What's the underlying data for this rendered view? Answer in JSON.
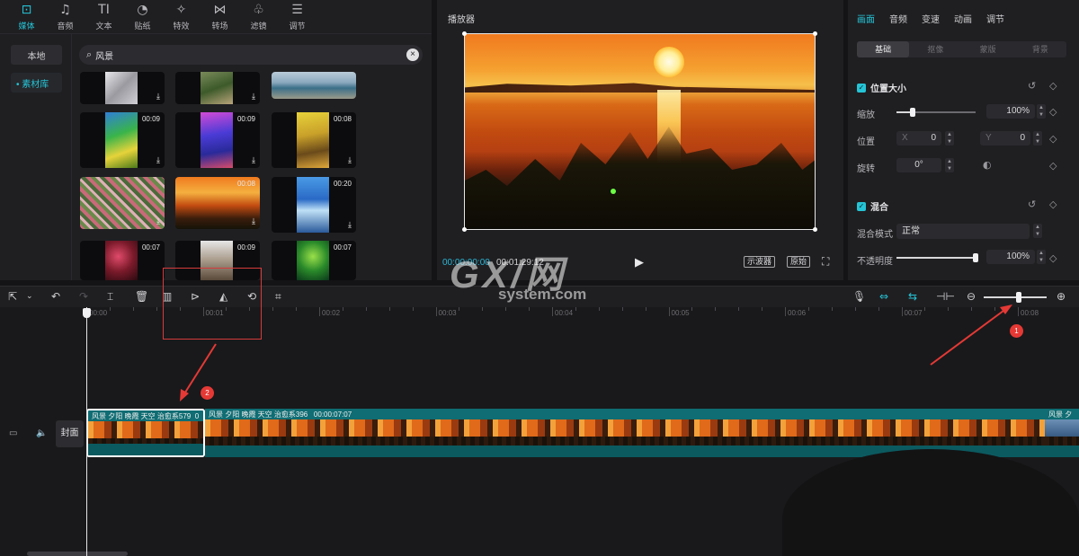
{
  "media": {
    "tabs": [
      {
        "label": "媒体",
        "icon": "media-icon",
        "glyph": "⊡"
      },
      {
        "label": "音频",
        "icon": "audio-icon",
        "glyph": "♫"
      },
      {
        "label": "文本",
        "icon": "text-icon",
        "glyph": "TI"
      },
      {
        "label": "贴纸",
        "icon": "sticker-icon",
        "glyph": "◔"
      },
      {
        "label": "特效",
        "icon": "effects-icon",
        "glyph": "✧"
      },
      {
        "label": "转场",
        "icon": "transition-icon",
        "glyph": "⋈"
      },
      {
        "label": "滤镜",
        "icon": "filter-icon",
        "glyph": "♧"
      },
      {
        "label": "调节",
        "icon": "adjust-icon",
        "glyph": "☰"
      }
    ],
    "sources": [
      "本地",
      "• 素材库"
    ],
    "search_value": "风景",
    "thumbs": [
      {
        "duration": "",
        "name": "snow-clip"
      },
      {
        "duration": "",
        "name": "path-clip"
      },
      {
        "duration": "",
        "name": "coast-clip"
      },
      {
        "duration": "00:09",
        "name": "forest-clip"
      },
      {
        "duration": "00:09",
        "name": "city-clip"
      },
      {
        "duration": "00:08",
        "name": "autumn-tree-clip"
      },
      {
        "duration": "",
        "name": "flowers-clip"
      },
      {
        "duration": "00:08",
        "name": "sunset-clip"
      },
      {
        "duration": "00:20",
        "name": "sky-clip"
      },
      {
        "duration": "00:07",
        "name": "blossom-clip"
      },
      {
        "duration": "00:09",
        "name": "ruins-clip"
      },
      {
        "duration": "00:07",
        "name": "green-clip"
      }
    ]
  },
  "player": {
    "title": "播放器",
    "current_time": "00:00:00:00",
    "total_time": "00:01:29:12",
    "scope_label": "示波器",
    "ratio_label": "原始"
  },
  "props": {
    "tabs": [
      "画面",
      "音频",
      "变速",
      "动画",
      "调节"
    ],
    "subtabs": [
      "基础",
      "抠像",
      "蒙版",
      "背景"
    ],
    "position_section": "位置大小",
    "scale_label": "缩放",
    "scale_value": "100%",
    "scale_level": 0.2,
    "position_label": "位置",
    "x_prefix": "X",
    "x_value": "0",
    "y_prefix": "Y",
    "y_value": "0",
    "rotate_label": "旋转",
    "rotate_value": "0°",
    "blend_section": "混合",
    "blend_mode_label": "混合模式",
    "blend_mode_value": "正常",
    "opacity_label": "不透明度",
    "opacity_value": "100%",
    "opacity_level": 1.0
  },
  "timeline": {
    "ruler": [
      "00:00",
      "00:01",
      "00:02",
      "00:03",
      "00:04",
      "00:05",
      "00:06",
      "00:07",
      "00:08"
    ],
    "cover_label": "封面",
    "clip1_title": "风景 夕阳 晚霞 天空 治愈系579",
    "clip1_extra": "0",
    "clip2_title": "风景 夕阳 晚霞 天空 治愈系396",
    "clip2_time": "00:00:07:07",
    "clip3_title": "风景 夕",
    "zoom_level": 0.55
  },
  "annotations": {
    "badge1": "1",
    "badge2": "2"
  },
  "watermark": {
    "main": "GX/网",
    "sub": "system.com"
  },
  "colors": {
    "accent": "#25c4d6",
    "annotation": "#e53935",
    "clip": "#0f6d73"
  }
}
